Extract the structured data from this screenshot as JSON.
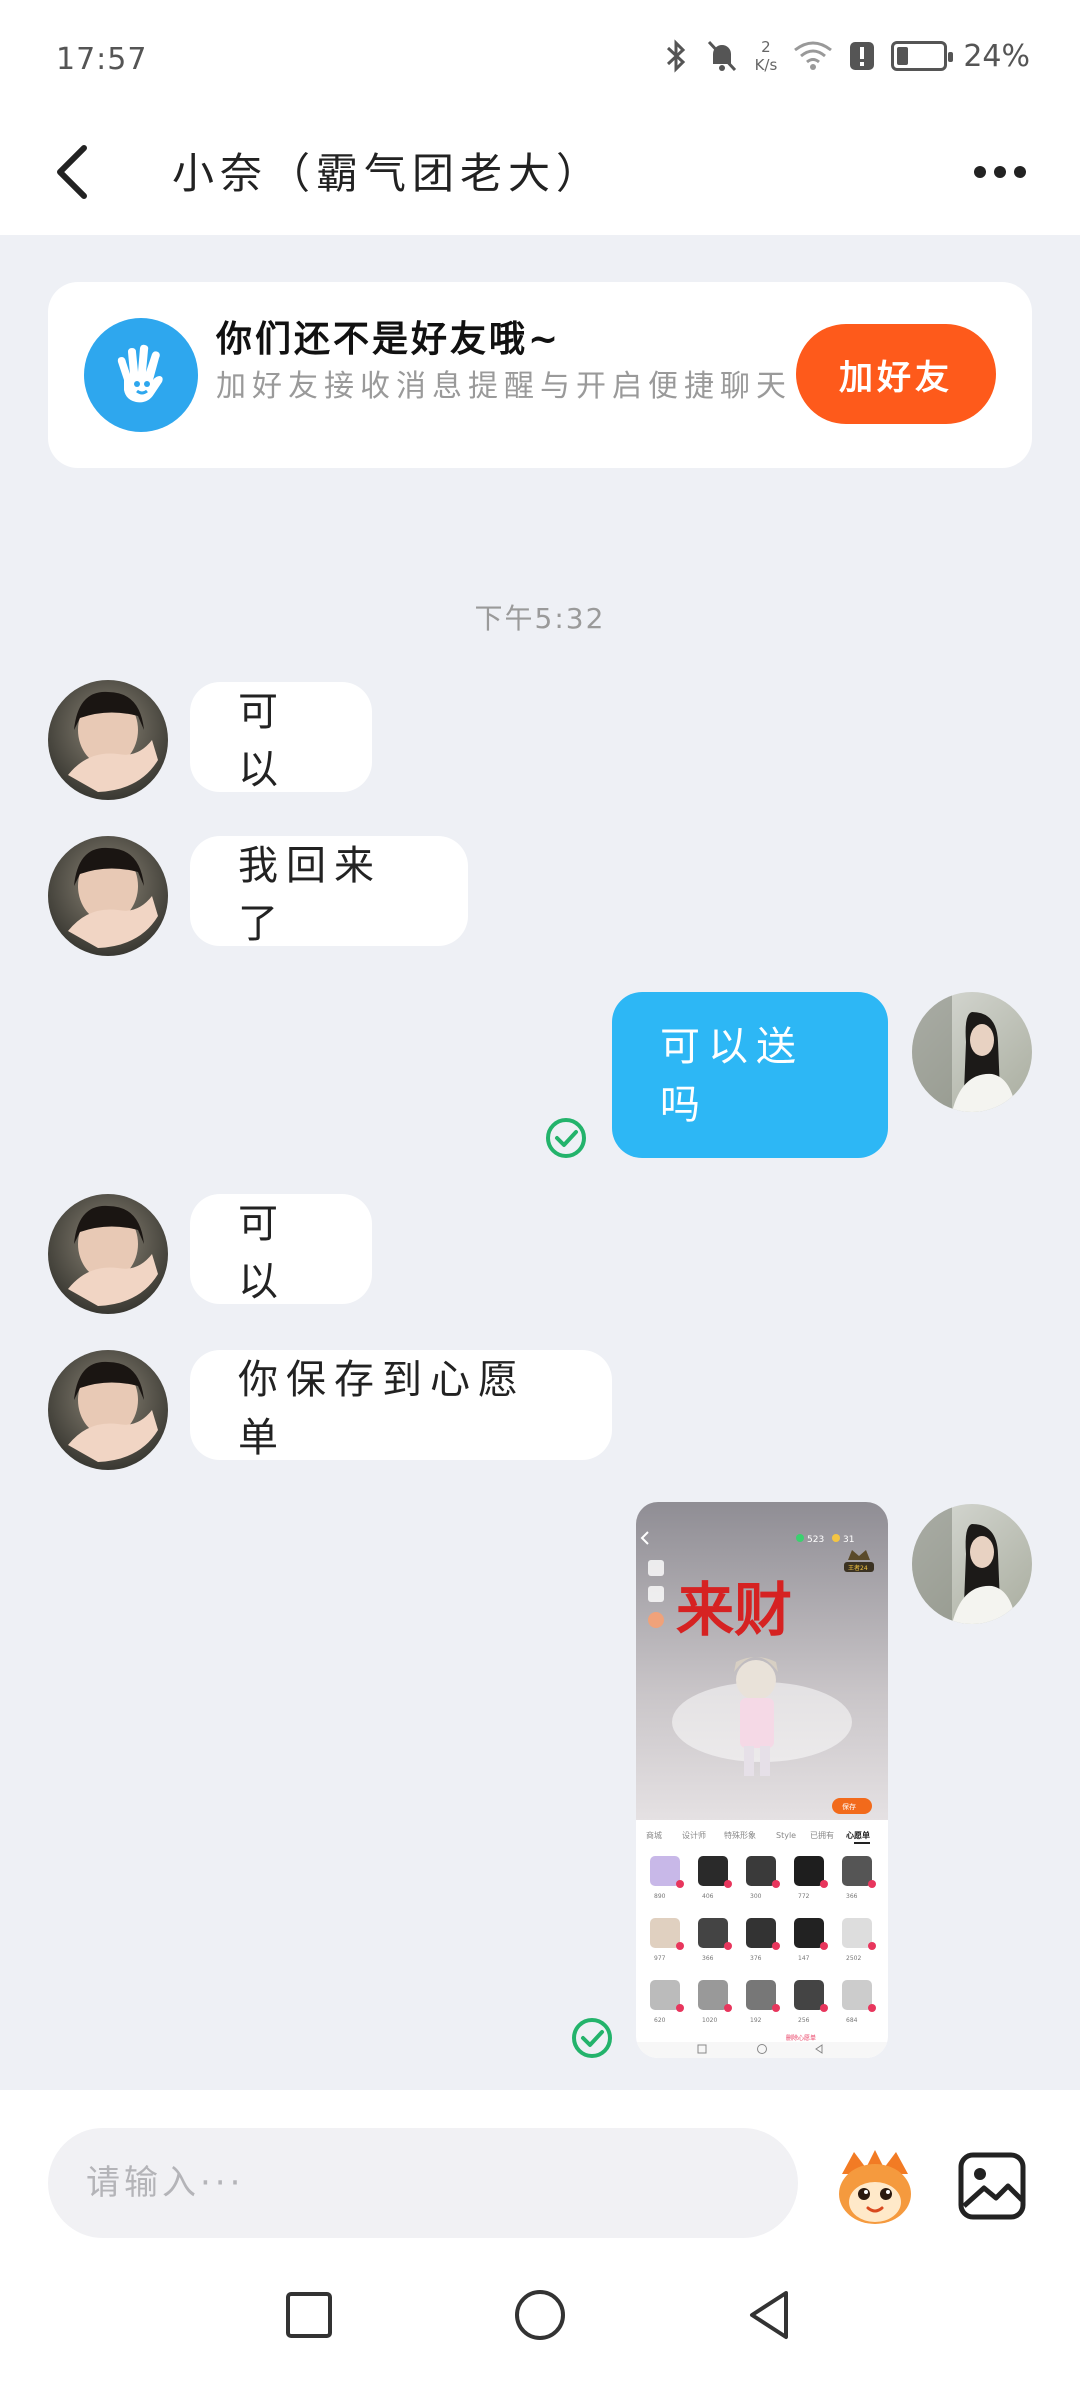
{
  "status_bar": {
    "time": "17:57",
    "net_speed_value": "2",
    "net_speed_unit": "K/s",
    "battery_percent_label": "24%",
    "battery_level": 0.24
  },
  "header": {
    "title": "小奈（霸气团老大）",
    "back_icon": "chevron-left-icon",
    "more_icon": "more-horizontal-icon"
  },
  "friend_banner": {
    "icon": "waving-hand-icon",
    "title": "你们还不是好友哦~",
    "subtitle": "加好友接收消息提醒与开启便捷聊天",
    "button_label": "加好友",
    "button_color": "#fe5a1b"
  },
  "timestamp": "下午5:32",
  "messages": [
    {
      "from": "them",
      "text": "可以"
    },
    {
      "from": "them",
      "text": "我回来了"
    },
    {
      "from": "me",
      "text": "可以送吗",
      "status": "read"
    },
    {
      "from": "them",
      "text": "可以"
    },
    {
      "from": "them",
      "text": "你保存到心愿单"
    },
    {
      "from": "me",
      "type": "image",
      "status": "read",
      "image_content": {
        "banner_text": "来财",
        "badge": "王者24",
        "coins_1": "523",
        "coins_2": "31",
        "save_label": "保存",
        "tabs": [
          "商城",
          "设计师",
          "特殊形象",
          "Style",
          "已拥有",
          "心愿单"
        ],
        "item_counts": [
          "890",
          "406",
          "300",
          "772",
          "366",
          "977",
          "366",
          "376",
          "147",
          "2502",
          "620",
          "1020",
          "192",
          "256",
          "684"
        ],
        "wishlist_note": "删除心愿单"
      }
    }
  ],
  "input_bar": {
    "placeholder": "请输入···",
    "emoji_icon": "mascot-emoji-icon",
    "image_icon": "image-picker-icon"
  },
  "nav_bar": {
    "recent_icon": "square-icon",
    "home_icon": "circle-icon",
    "back_icon": "triangle-back-icon"
  },
  "colors": {
    "accent_blue": "#2db7f5",
    "background": "#eef0f5",
    "read_check": "#23b36b"
  }
}
